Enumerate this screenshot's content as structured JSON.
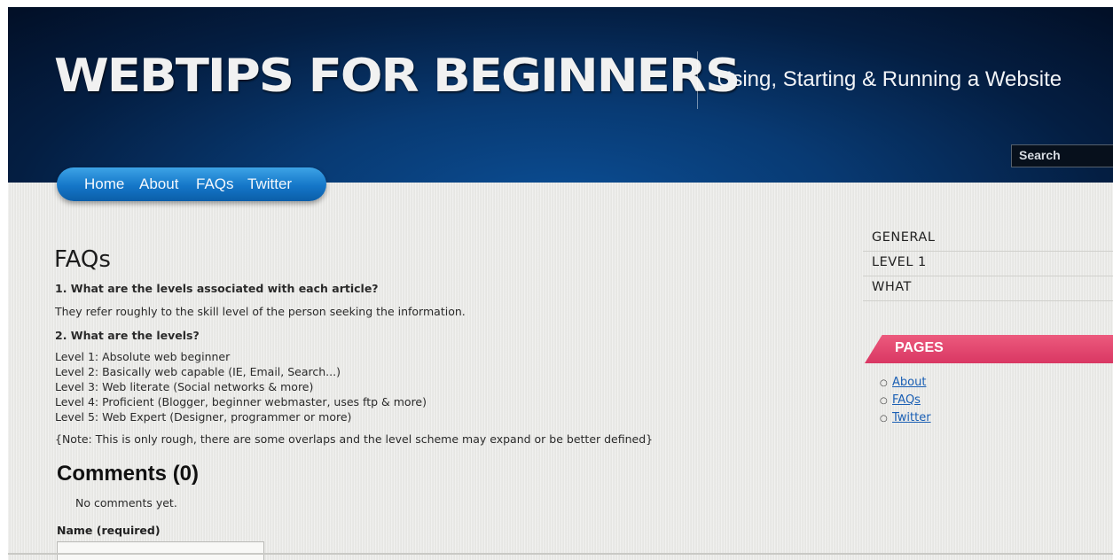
{
  "site": {
    "logo": "WEBTIPS FOR BEGINNERS",
    "tagline": "Using, Starting & Running a Website",
    "search_label": "Search"
  },
  "nav": {
    "items": [
      {
        "label": "Home"
      },
      {
        "label": "About"
      },
      {
        "label": "FAQs"
      },
      {
        "label": "Twitter"
      }
    ]
  },
  "main": {
    "title": "FAQs",
    "q1": "1. What are the levels associated with each article?",
    "a1": "They refer roughly to the skill level of the person seeking the information.",
    "q2": "2. What are the levels?",
    "levels": [
      "Level 1: Absolute web beginner",
      "Level 2: Basically web capable (IE, Email, Search...)",
      "Level 3: Web literate (Social networks & more)",
      "Level 4: Proficient (Blogger, beginner webmaster, uses ftp & more)",
      "Level 5: Web Expert (Designer, programmer or more)"
    ],
    "note": "{Note: This is only rough, there are some overlaps and the level scheme may expand or be better defined}"
  },
  "comments": {
    "heading": "Comments (0)",
    "empty_text": "No comments yet.",
    "name_label": "Name (required)"
  },
  "sidebar": {
    "categories": [
      "GENERAL",
      "LEVEL 1",
      "WHAT"
    ],
    "pages_heading": "PAGES",
    "pages": [
      "About",
      "FAQs",
      "Twitter"
    ]
  },
  "colors": {
    "header_blue": "#083a73",
    "nav_blue": "#1476c8",
    "pages_pink": "#d93763",
    "link_blue": "#1a5fb4"
  }
}
